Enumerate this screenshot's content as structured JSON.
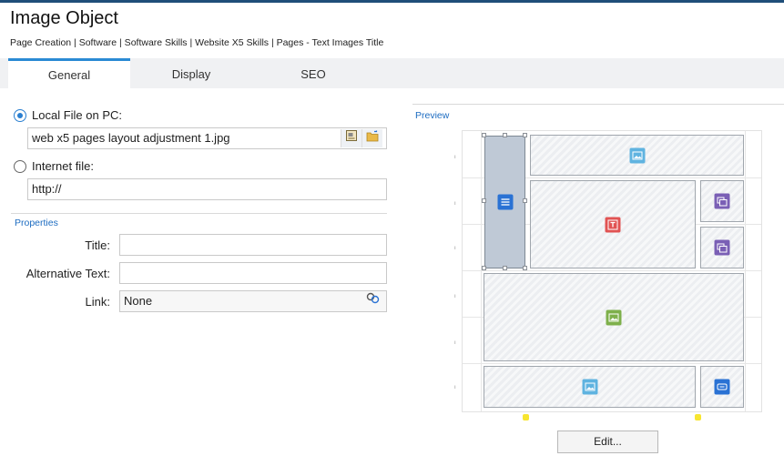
{
  "window": {
    "title": "Image Object",
    "breadcrumb": "Page Creation | Software | Software Skills | Website X5 Skills | Pages - Text Images Title"
  },
  "tabs": [
    {
      "label": "General",
      "active": true
    },
    {
      "label": "Display",
      "active": false
    },
    {
      "label": "SEO",
      "active": false
    }
  ],
  "source": {
    "local_file": {
      "label": "Local File on PC:",
      "selected": true,
      "value": "web x5 pages layout adjustment 1.jpg"
    },
    "internet_file": {
      "label": "Internet file:",
      "selected": false,
      "value": "http://"
    }
  },
  "properties": {
    "section_title": "Properties",
    "title": {
      "label": "Title:",
      "value": ""
    },
    "alt_text": {
      "label": "Alternative Text:",
      "value": ""
    },
    "link": {
      "label": "Link:",
      "value": "None"
    }
  },
  "preview": {
    "section_title": "Preview",
    "edit_label": "Edit..."
  },
  "colors": {
    "accent": "#2a8ad4",
    "section_blue": "#1d6cc1",
    "icon_image": "#5fb3e0",
    "icon_text": "#e15353",
    "icon_gallery": "#7a5fb5",
    "icon_green": "#7eb04b",
    "icon_blue": "#2a72d4"
  }
}
